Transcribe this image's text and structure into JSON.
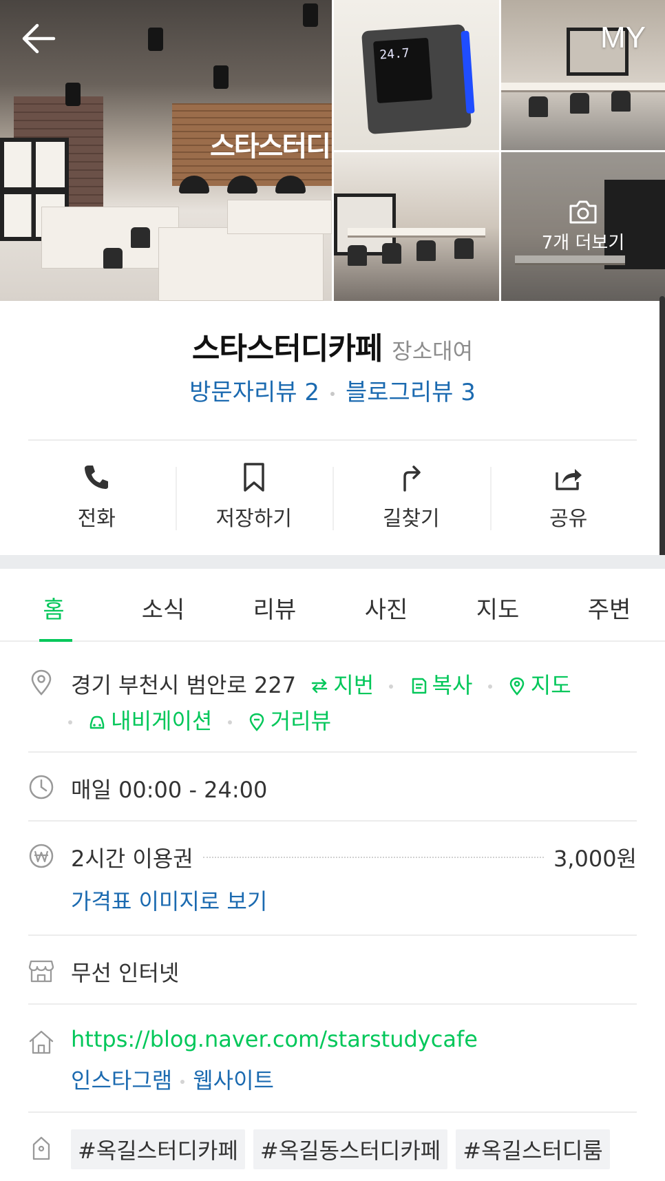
{
  "header": {
    "my_label": "MY",
    "more_photos_label": "7개 더보기",
    "sign_text": "스타스터디"
  },
  "place": {
    "name": "스타스터디카페",
    "category": "장소대여",
    "visitor_review": "방문자리뷰 2",
    "blog_review": "블로그리뷰 3"
  },
  "actions": [
    {
      "label": "전화",
      "icon": "phone-icon"
    },
    {
      "label": "저장하기",
      "icon": "bookmark-icon"
    },
    {
      "label": "길찾기",
      "icon": "directions-icon"
    },
    {
      "label": "공유",
      "icon": "share-icon"
    }
  ],
  "tabs": [
    {
      "label": "홈",
      "active": true
    },
    {
      "label": "소식",
      "active": false
    },
    {
      "label": "리뷰",
      "active": false
    },
    {
      "label": "사진",
      "active": false
    },
    {
      "label": "지도",
      "active": false
    },
    {
      "label": "주변",
      "active": false
    }
  ],
  "address": {
    "text": "경기 부천시 범안로 227",
    "jibun": "지번",
    "copy": "복사",
    "map": "지도",
    "navigation": "내비게이션",
    "street_view": "거리뷰"
  },
  "hours": {
    "text": "매일 00:00 - 24:00"
  },
  "price": {
    "item": "2시간 이용권",
    "amount": "3,000원",
    "view_link": "가격표 이미지로 보기"
  },
  "amenity": {
    "text": "무선 인터넷"
  },
  "homepage": {
    "url": "https://blog.naver.com/starstudycafe",
    "instagram": "인스타그램",
    "website": "웹사이트"
  },
  "tags": [
    "#옥길스터디카페",
    "#옥길동스터디카페",
    "#옥길스터디룸"
  ],
  "colors": {
    "accent_green": "#03c75a",
    "link_blue": "#1b6ab0",
    "text": "#333333",
    "muted": "#8d8d8d"
  }
}
